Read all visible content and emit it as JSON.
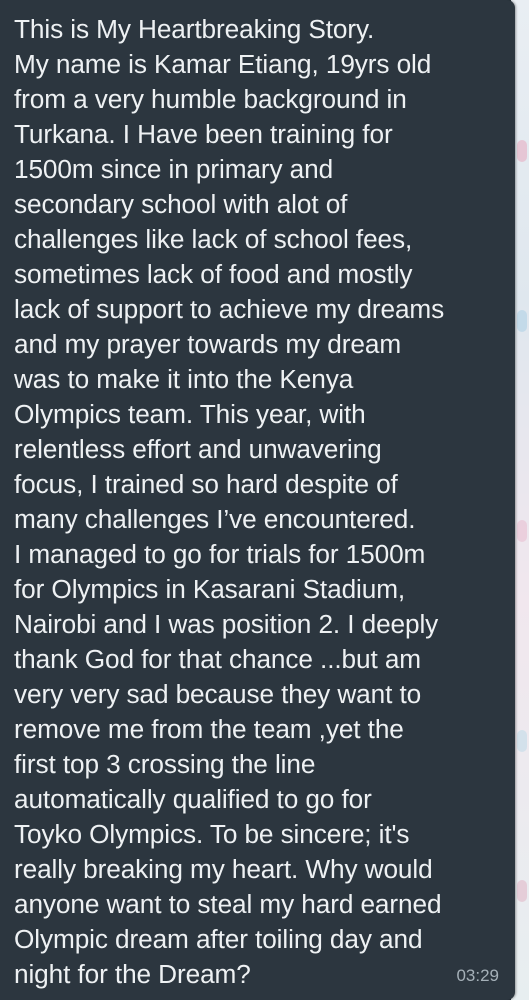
{
  "message": {
    "text": "This is My Heartbreaking Story.\nMy name is Kamar Etiang, 19yrs old\nfrom a very humble background in\nTurkana. I Have been training for\n1500m since  in primary and\nsecondary school with alot of\nchallenges like lack of school fees,\nsometimes lack of food and mostly\nlack of support to achieve my dreams\nand my prayer towards my dream\nwas to make it into the Kenya\nOlympics team. This year, with\nrelentless effort and unwavering\nfocus,  I trained so hard despite of\nmany challenges I’ve encountered.\nI managed to go for trials for 1500m\nfor Olympics in Kasarani Stadium,\nNairobi and I was position 2. I deeply\nthank God for that chance ...but am\nvery very sad   because they want to\nremove me from the team ,yet the\nfirst top 3 crossing the line\nautomatically qualified to go for\nToyko Olympics. To be sincere;  it's\nreally breaking my heart. Why would\nanyone want to steal my hard earned\nOlympic dream after toiling day and\nnight for the Dream?",
    "time": "03:29"
  },
  "colors": {
    "bubble": "#2c363f",
    "text": "#eef1f3",
    "timestamp": "#a5b0b8"
  }
}
